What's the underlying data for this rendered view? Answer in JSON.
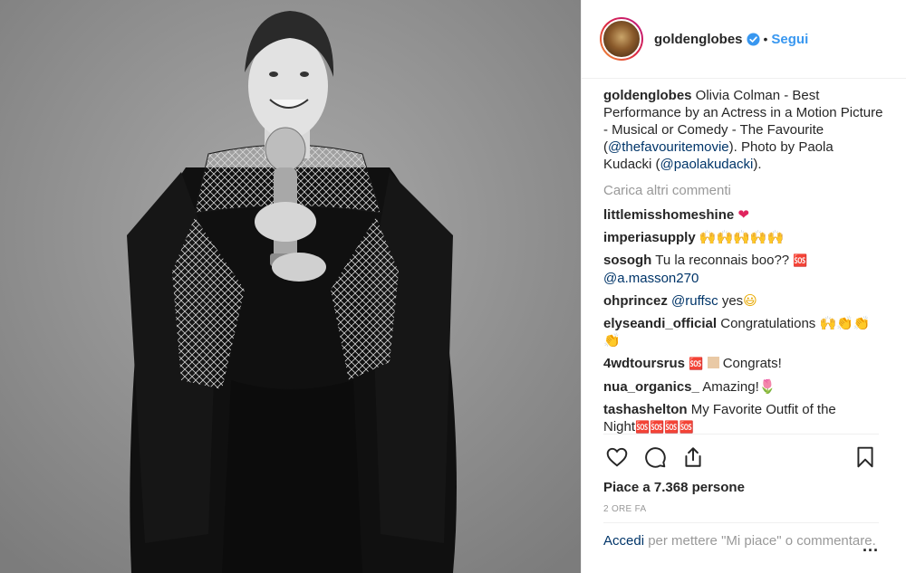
{
  "post": {
    "username": "goldenglobes",
    "follow_label": "Segui",
    "separator": "•",
    "caption_text": "Olivia Colman - Best Performance by an Actress in a Motion Picture - Musical or Comedy - The Favourite (",
    "caption_mention1": "@thefavouritemovie",
    "caption_mid": "). Photo by Paola Kudacki (",
    "caption_mention2": "@paolakudacki",
    "caption_end": ")."
  },
  "load_more": "Carica altri commenti",
  "comments": [
    {
      "user": "littlemisshomeshine",
      "text": "",
      "emoji": "❤"
    },
    {
      "user": "imperiasupply",
      "text": "",
      "emoji": "🙌🙌🙌🙌🙌"
    },
    {
      "user": "sosogh",
      "text": "Tu la reconnais boo?? ",
      "emoji": "🆘",
      "mention": "@a.masson270"
    },
    {
      "user": "ohprincez",
      "mention": "@ruffsc",
      "text": " yes",
      "emoji": "😃"
    },
    {
      "user": "elyseandi_official",
      "text": "Congratulations ",
      "emoji": "🙌👏👏👏"
    },
    {
      "user": "4wdtoursrus",
      "emoji": "🆘",
      "text": " Congrats!"
    },
    {
      "user": "nua_organics_",
      "text": "Amazing!",
      "emoji": "🌷"
    },
    {
      "user": "tashashelton",
      "text": "My Favorite Outfit of the Night",
      "emoji": "🆘🆘🆘🆘"
    }
  ],
  "likes": "Piace a 7.368 persone",
  "time": "2 ORE FA",
  "add_comment": {
    "login": "Accedi",
    "rest": " per mettere \"Mi piace\" o commentare.",
    "more": "..."
  },
  "colors": {
    "link": "#003569",
    "follow": "#3897f0",
    "muted": "#999999",
    "verified": "#3897f0"
  },
  "icons": [
    "heart-icon",
    "comment-icon",
    "share-icon",
    "bookmark-icon",
    "verified-icon",
    "more-options-icon"
  ]
}
